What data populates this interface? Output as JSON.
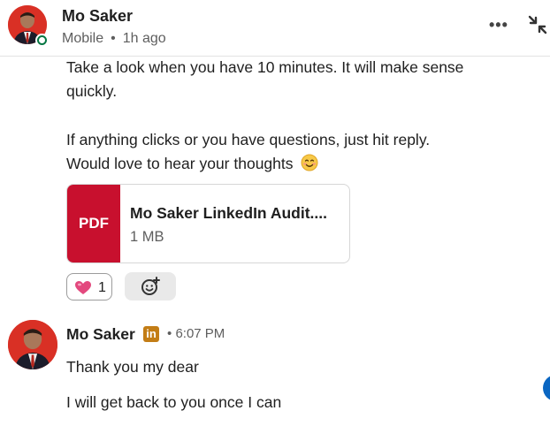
{
  "header": {
    "name": "Mo Saker",
    "status": "Mobile",
    "separator": "•",
    "time_ago": "1h ago",
    "more_label": "•••"
  },
  "message1": {
    "lines": [
      "Take a look when you have 10 minutes. It will make sense",
      "quickly.",
      "If anything clicks or you have questions, just hit reply.",
      "Would love to hear your thoughts"
    ],
    "emoji": "smiling-face-icon"
  },
  "attachment": {
    "type_label": "PDF",
    "file_name": "Mo Saker LinkedIn Audit....",
    "file_size": "1 MB"
  },
  "reactions": {
    "heart_count": "1"
  },
  "message2": {
    "sender": "Mo Saker",
    "badge": "in",
    "separator": "•",
    "time": "6:07 PM",
    "lines": [
      "Thank you my dear",
      "I will get back to you once I can"
    ]
  },
  "colors": {
    "pdf_red": "#c8102e",
    "online_green": "#057642",
    "premium_gold": "#c37d16",
    "linkedin_blue": "#0a66c2"
  }
}
